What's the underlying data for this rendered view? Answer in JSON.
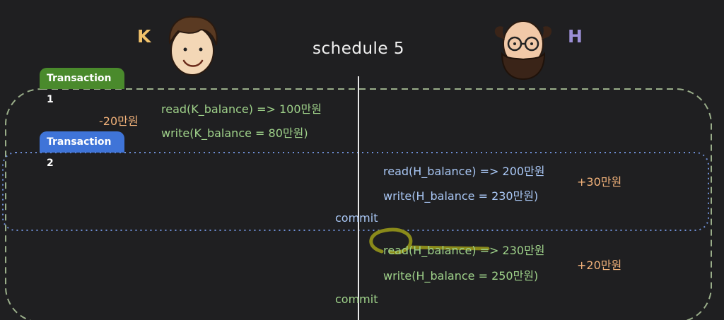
{
  "title": "schedule 5",
  "users": {
    "k_letter": "K",
    "h_letter": "H"
  },
  "transaction1": {
    "label": "Transaction 1",
    "read_op": "read(K_balance) => 100만원",
    "write_op": "write(K_balance = 80만원)",
    "delta": "-20만원",
    "read2_op": "read(H_balance) => 230만원",
    "write2_op": "write(H_balance = 250만원)",
    "delta2": "+20만원",
    "commit": "commit"
  },
  "transaction2": {
    "label": "Transaction 2",
    "read_op": "read(H_balance) => 200만원",
    "write_op": "write(H_balance = 230만원)",
    "delta": "+30만원",
    "commit": "commit"
  },
  "colors": {
    "transaction1": "#4a8a2c",
    "transaction2": "#3f74d8",
    "highlight_scribble": "#8a8a1a"
  },
  "icons": [
    "k-avatar-icon",
    "h-avatar-icon"
  ]
}
